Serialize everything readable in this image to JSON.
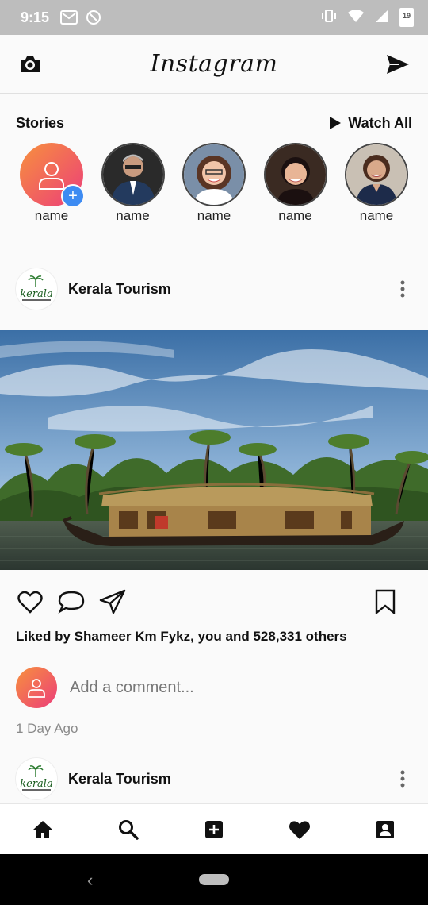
{
  "status_bar": {
    "time": "9:15",
    "battery_level": "19"
  },
  "app_bar": {
    "title": "Instagram"
  },
  "stories": {
    "title": "Stories",
    "watch_all_label": "Watch All",
    "items": [
      {
        "name": "name",
        "kind": "add-story"
      },
      {
        "name": "name",
        "kind": "photo"
      },
      {
        "name": "name",
        "kind": "photo"
      },
      {
        "name": "name",
        "kind": "photo"
      },
      {
        "name": "name",
        "kind": "photo"
      }
    ]
  },
  "post": {
    "author": "Kerala Tourism",
    "logo_text": "kerala",
    "likes_text": "Liked by Shameer Km Fykz, you and 528,331 others",
    "comment_placeholder": "Add a comment...",
    "timestamp": "1 Day Ago"
  },
  "next_post": {
    "author": "Kerala Tourism",
    "logo_text": "kerala"
  },
  "bottom_nav": [
    "home-icon",
    "search-icon",
    "add-post-icon",
    "activity-heart-icon",
    "profile-icon"
  ],
  "colors": {
    "accent_gradient_start": "#f7913d",
    "accent_gradient_end": "#ec3d7a",
    "add_badge": "#3d8bf2"
  }
}
